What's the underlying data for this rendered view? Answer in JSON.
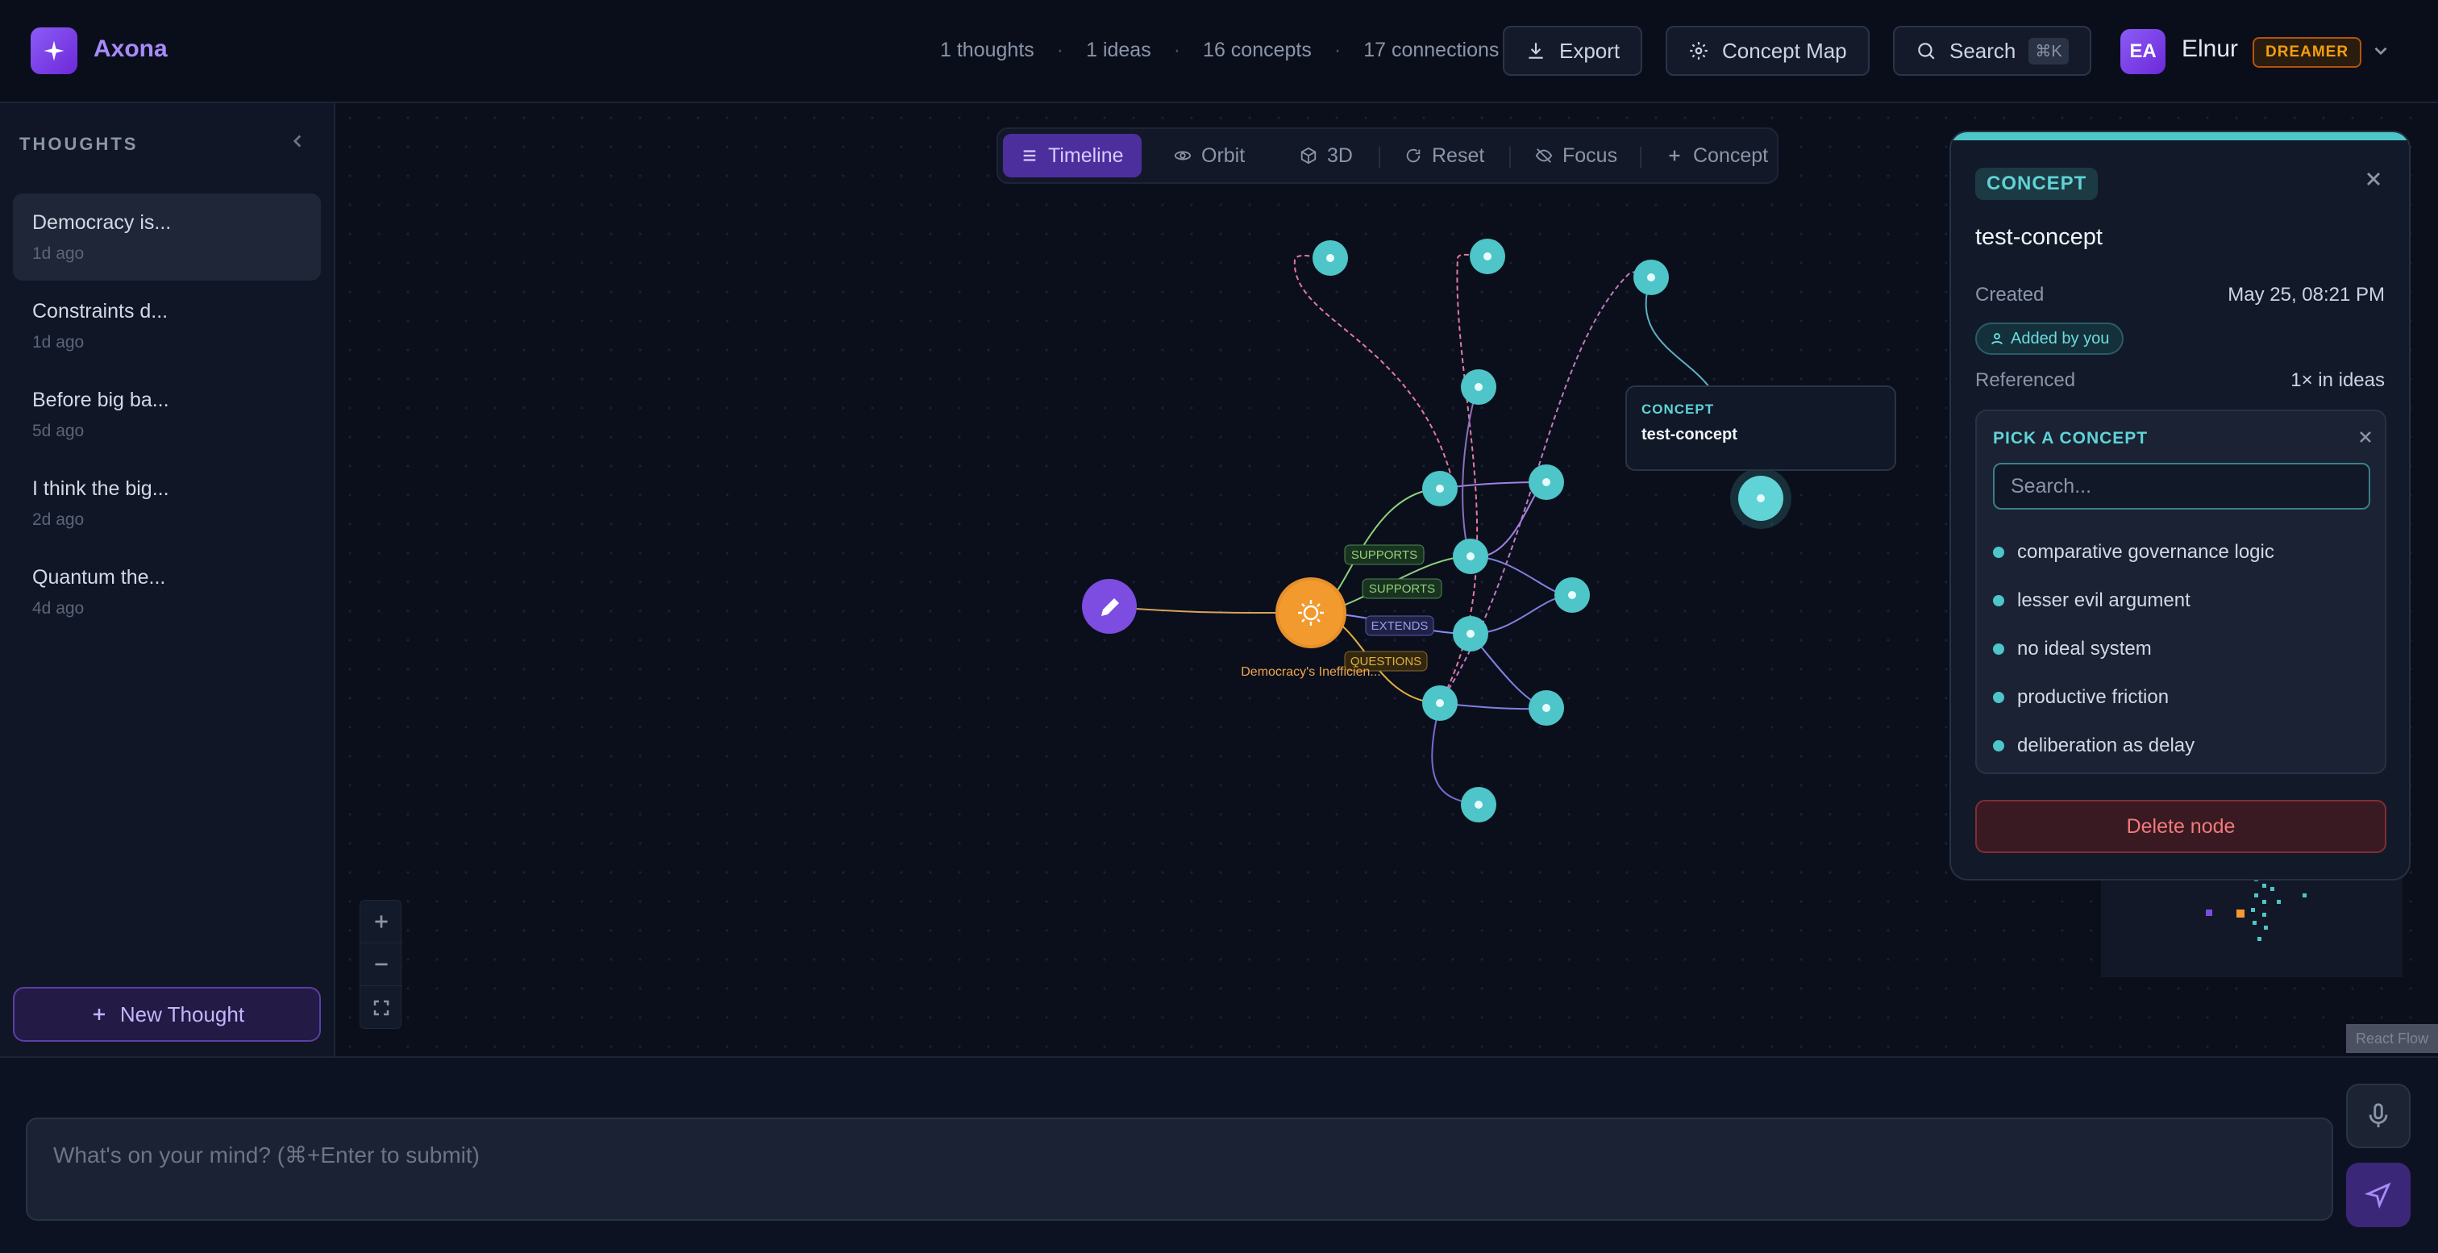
{
  "app": {
    "name": "Axona"
  },
  "header": {
    "stats": [
      "1 thoughts",
      "1 ideas",
      "16 concepts",
      "17 connections"
    ],
    "stat_separator": "·",
    "export_label": "Export",
    "concept_map_label": "Concept Map",
    "search_label": "Search",
    "search_shortcut": "⌘K",
    "user_initials": "EA",
    "user_name": "Elnur",
    "user_badge": "DREAMER"
  },
  "sidebar": {
    "title": "THOUGHTS",
    "items": [
      {
        "title": "Democracy is...",
        "date": "1d ago"
      },
      {
        "title": "Constraints d...",
        "date": "1d ago"
      },
      {
        "title": "Before big ba...",
        "date": "5d ago"
      },
      {
        "title": "I think the big...",
        "date": "2d ago"
      },
      {
        "title": "Quantum the...",
        "date": "4d ago"
      }
    ],
    "new_thought_label": "New Thought"
  },
  "toolbar": {
    "buttons": [
      "Timeline",
      "Orbit",
      "3D",
      "Reset",
      "Focus",
      "Concept"
    ],
    "active": "Timeline"
  },
  "graph": {
    "idea_label": "Democracy's Inefficien...",
    "edge_labels": [
      "SUPPORTS",
      "SUPPORTS",
      "EXTENDS",
      "QUESTIONS"
    ],
    "hover_card": {
      "kind": "CONCEPT",
      "name": "test-concept"
    }
  },
  "panel": {
    "chip": "CONCEPT",
    "title": "test-concept",
    "created_label": "Created",
    "created_value": "May 25, 08:21 PM",
    "added_by": "Added by you",
    "referenced_label": "Referenced",
    "referenced_value": "1× in ideas",
    "picker": {
      "title": "PICK A CONCEPT",
      "search_placeholder": "Search...",
      "options": [
        "comparative governance logic",
        "lesser evil argument",
        "no ideal system",
        "productive friction",
        "deliberation as delay"
      ]
    },
    "delete_label": "Delete node"
  },
  "attribution": "React Flow",
  "composer": {
    "placeholder": "What's on your mind? (⌘+Enter to submit)"
  },
  "colors": {
    "accent_purple": "#8b5cf6",
    "concept_teal": "#4ec5c8",
    "idea_orange": "#f29a2e",
    "danger": "#f07a7a",
    "badge_amber": "#f59e0b"
  }
}
